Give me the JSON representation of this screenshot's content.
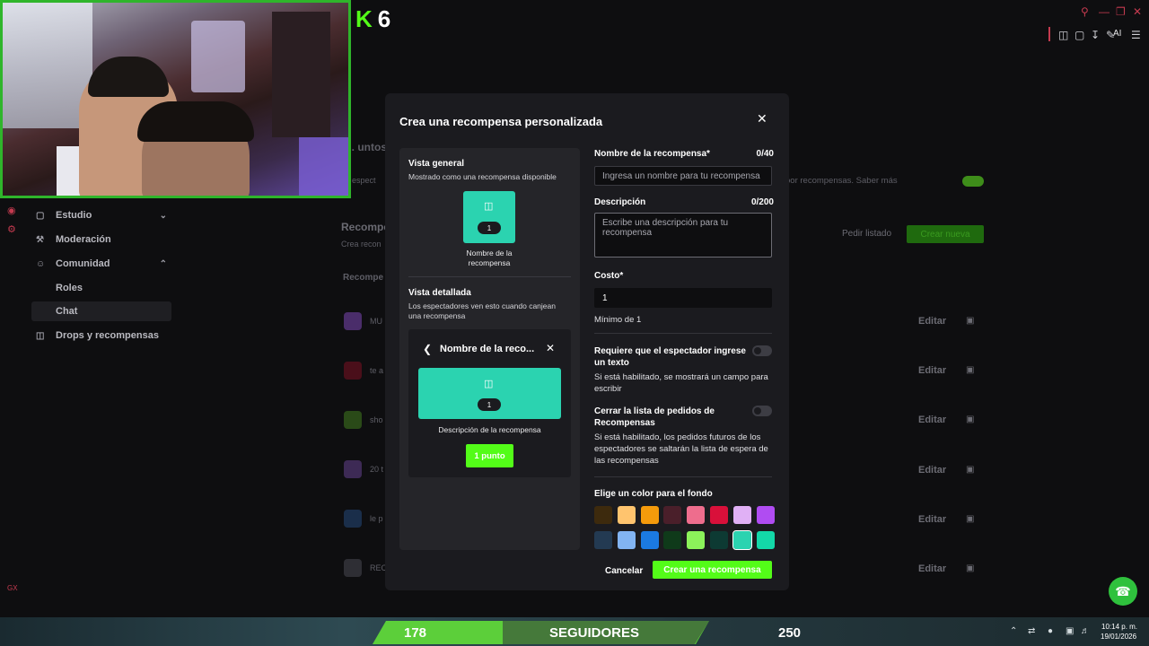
{
  "app": {
    "logo_k": "K",
    "logo_num": "6",
    "toolbar_ai": "AI",
    "window_icons": [
      "search-icon",
      "minimize-icon",
      "restore-icon",
      "close-icon"
    ],
    "toolbar_icons": [
      "extension-icon",
      "bag-icon",
      "download-icon",
      "compose-icon",
      "menu-icon"
    ]
  },
  "sidebar": {
    "items": [
      {
        "label": "Estudio",
        "icon": "studio-icon",
        "expand": "chevron-down"
      },
      {
        "label": "Moderación",
        "icon": "wrench-icon"
      },
      {
        "label": "Comunidad",
        "icon": "community-icon",
        "expand": "chevron-up"
      },
      {
        "label": "Drops y recompensas",
        "icon": "gift-icon"
      }
    ],
    "sub_items": [
      "Roles",
      "Chat"
    ]
  },
  "background": {
    "fragments": [
      "... untos c",
      "s espect",
      "Recompe",
      "Crea recon",
      "Recompe"
    ],
    "rows": [
      "MU",
      "te a",
      "sho",
      "20 t",
      "le p",
      "REC"
    ],
    "setting_text": "por recompensas. Saber más",
    "request_list": "Pedir listado",
    "create_button": "Crear nueva",
    "edit_label": "Editar"
  },
  "modal": {
    "title": "Crea una recompensa personalizada",
    "preview": {
      "overview_heading": "Vista general",
      "overview_sub": "Mostrado como una recompensa disponible",
      "card_cost": "1",
      "card_name": "Nombre de la recompensa",
      "detail_heading": "Vista detallada",
      "detail_sub": "Los espectadores ven esto cuando canjean una recompensa",
      "detail_title": "Nombre de la reco...",
      "banner_cost": "1",
      "description": "Descripción de la recompensa",
      "points_button": "1 punto"
    },
    "form": {
      "name_label": "Nombre de la recompensa*",
      "name_count": "0/40",
      "name_placeholder": "Ingresa un nombre para tu recompensa",
      "desc_label": "Descripción",
      "desc_count": "0/200",
      "desc_placeholder": "Escribe una descripción para tu recompensa",
      "cost_label": "Costo*",
      "cost_value": "1",
      "cost_help": "Mínimo de 1",
      "require_text_label": "Requiere que el espectador ingrese un texto",
      "require_text_help": "Si está habilitado, se mostrará un campo para escribir",
      "require_text_enabled": false,
      "close_queue_label": "Cerrar la lista de pedidos de Recompensas",
      "close_queue_help": "Si está habilitado, los pedidos futuros de los espectadores se saltarán la lista de espera de las recompensas",
      "close_queue_enabled": false,
      "color_label": "Elige un color para el fondo",
      "colors": [
        "#3d2a0d",
        "#ffc46e",
        "#f59b0b",
        "#4a1f2a",
        "#ee6d8d",
        "#d9103a",
        "#e0b0f5",
        "#b04cf2",
        "#233a52",
        "#82b4f2",
        "#1b7ae0",
        "#0f3a1a",
        "#8cf25a",
        "#0d3a33",
        "#2bd3b0",
        "#13d8a8"
      ],
      "selected_color": "#2bd3b0",
      "cancel": "Cancelar",
      "submit": "Crear una recompensa"
    }
  },
  "overlay": {
    "followers_current": "178",
    "followers_label": "SEGUIDORES",
    "followers_goal": "250",
    "gx": "GX",
    "clock_time": "10:14 p. m.",
    "clock_date": "19/01/2026"
  }
}
